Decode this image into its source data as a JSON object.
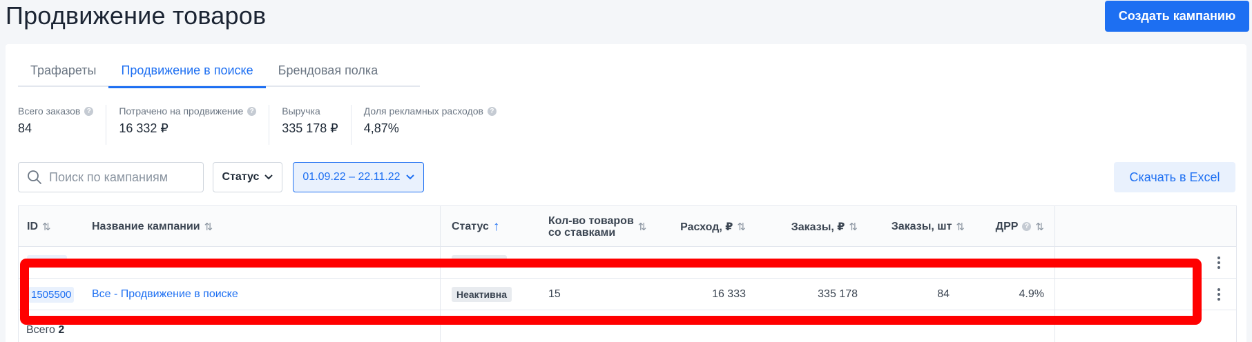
{
  "header": {
    "title": "Продвижение товаров",
    "create_button": "Создать кампанию"
  },
  "tabs": [
    {
      "label": "Трафареты",
      "active": false
    },
    {
      "label": "Продвижение в поиске",
      "active": true
    },
    {
      "label": "Брендовая полка",
      "active": false
    }
  ],
  "stats": [
    {
      "label": "Всего заказов",
      "value": "84",
      "help": true
    },
    {
      "label": "Потрачено на продвижение",
      "value": "16 332 ₽",
      "help": true
    },
    {
      "label": "Выручка",
      "value": "335 178 ₽",
      "help": false
    },
    {
      "label": "Доля рекламных расходов",
      "value": "4,87%",
      "help": true
    }
  ],
  "filters": {
    "search_placeholder": "Поиск по кампаниям",
    "status_label": "Статус",
    "date_range": "01.09.22 – 22.11.22",
    "excel_button": "Скачать в Excel"
  },
  "table": {
    "columns": {
      "id": "ID",
      "name": "Название кампании",
      "status": "Статус",
      "items_line1": "Кол-во товаров",
      "items_line2": "со ставками",
      "spend": "Расход, ₽",
      "orders_rub": "Заказы, ₽",
      "orders_qty": "Заказы, шт",
      "drr": "ДРР"
    },
    "rows": [
      {
        "id": "1505500",
        "name": "Все - Продвижение в поиске",
        "status": "Неактивна",
        "items": "15",
        "spend": "16 333",
        "orders_rub": "335 178",
        "orders_qty": "84",
        "drr": "4.9%"
      }
    ],
    "total_label": "Всего",
    "total_value": "2"
  },
  "colors": {
    "accent": "#1d6ff2",
    "highlight": "#ff0000"
  }
}
